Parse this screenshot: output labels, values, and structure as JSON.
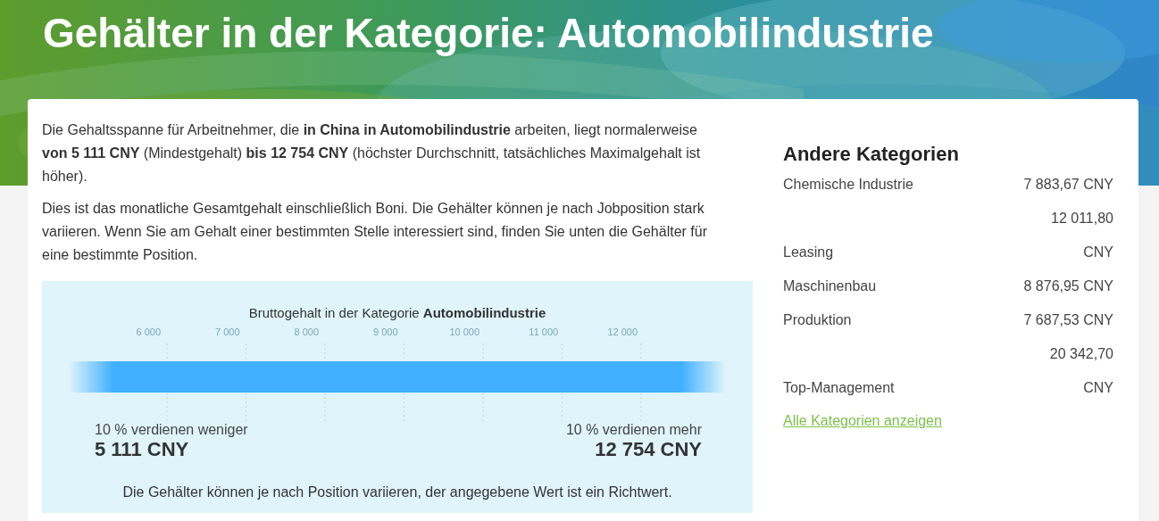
{
  "title": "Gehälter in der Kategorie: Automobilindustrie",
  "intro": [
    "Die Gehaltsspanne für Arbeitnehmer, die **in China in Automobilindustrie** arbeiten, liegt normalerweise **von 5 111 CNY** (Mindestgehalt) **bis 12 754 CNY** (höchster Durchschnitt, tatsächliches Maximalgehalt ist höher).",
    "Dies ist das monatliche Gesamtgehalt einschließlich Boni. Die Gehälter können je nach Jobposition stark variieren. Wenn Sie am Gehalt einer bestimmten Stelle interessiert sind, finden Sie unten die Gehälter für eine bestimmte Position."
  ],
  "range": {
    "title": "Bruttogehalt in der Kategorie **Automobilindustrie**",
    "ticks": [
      "6 000",
      "7 000",
      "8 000",
      "9 000",
      "10 000",
      "11 000",
      "12 000"
    ],
    "low": {
      "label": "10 % verdienen weniger",
      "value": "5 111 CNY"
    },
    "high": {
      "label": "10 % verdienen mehr",
      "value": "12 754 CNY"
    },
    "note": "Die Gehälter können je nach Position variieren, der angegebene Wert ist ein Richtwert."
  },
  "sidebar": {
    "heading": "Andere Kategorien",
    "categories": [
      {
        "name": "Chemische Industrie",
        "value_lines": [
          "7 883,67 CNY"
        ]
      },
      {
        "name": "Leasing",
        "value_lines": [
          "12 011,80",
          "CNY"
        ]
      },
      {
        "name": "Maschinenbau",
        "value_lines": [
          "8 876,95 CNY"
        ]
      },
      {
        "name": "Produktion",
        "value_lines": [
          "7 687,53 CNY"
        ]
      },
      {
        "name": "Top-Management",
        "value_lines": [
          "20 342,70",
          "CNY"
        ]
      }
    ],
    "link": "Alle Kategorien anzeigen"
  }
}
